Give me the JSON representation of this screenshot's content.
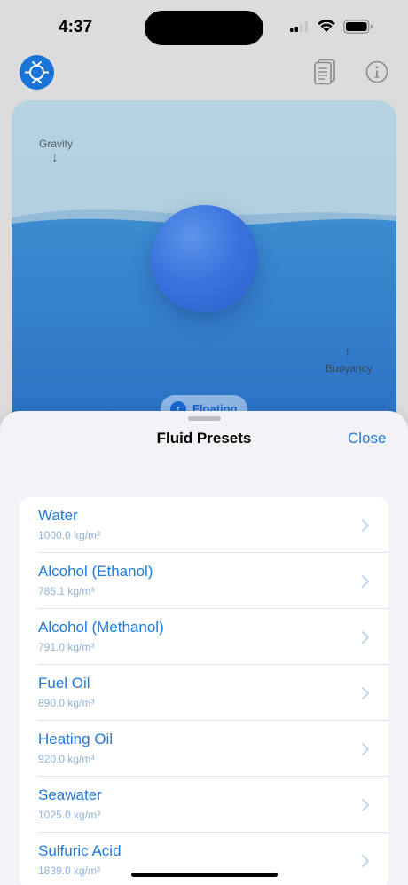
{
  "status_bar": {
    "time": "4:37"
  },
  "nav": {
    "logo_icon": "buoy-logo-icon",
    "notes_icon": "notes-icon",
    "info_icon": "info-icon"
  },
  "simulation": {
    "gravity_label": "Gravity",
    "gravity_arrow": "↓",
    "buoyancy_label": "Buoyancy",
    "buoyancy_arrow": "↑",
    "status_label": "Floating",
    "status_icon": "↑"
  },
  "sheet": {
    "title": "Fluid Presets",
    "close_label": "Close",
    "presets": [
      {
        "name": "Water",
        "density": "1000.0 kg/m³"
      },
      {
        "name": "Alcohol (Ethanol)",
        "density": "785.1 kg/m³"
      },
      {
        "name": "Alcohol (Methanol)",
        "density": "791.0 kg/m³"
      },
      {
        "name": "Fuel Oil",
        "density": "890.0 kg/m³"
      },
      {
        "name": "Heating Oil",
        "density": "920.0 kg/m³"
      },
      {
        "name": "Seawater",
        "density": "1025.0 kg/m³"
      },
      {
        "name": "Sulfuric Acid",
        "density": "1839.0 kg/m³"
      }
    ]
  },
  "colors": {
    "accent": "#1f7ae0",
    "fluid_top": "#3c8cd0",
    "fluid_bottom": "#2a6dc2",
    "ball": "#3b74de"
  }
}
